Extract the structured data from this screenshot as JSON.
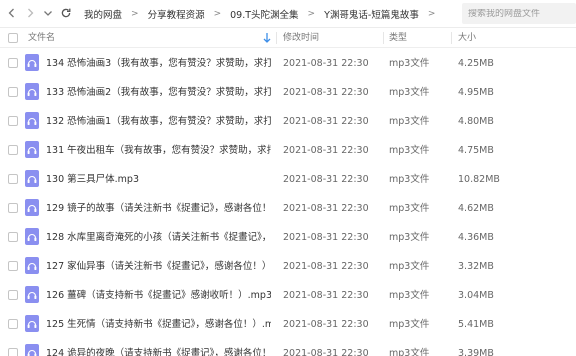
{
  "breadcrumb": [
    "我的网盘",
    "分享教程资源",
    "09.T头陀渊全集",
    "Y渊哥鬼话-短篇鬼故事"
  ],
  "search": {
    "placeholder": "搜索我的网盘文件"
  },
  "columns": {
    "name": "文件名",
    "date": "修改时间",
    "type": "类型",
    "size": "大小"
  },
  "colors": {
    "icon_bg": "#8a8ff0",
    "icon_fg": "#ffffff",
    "sort_arrow": "#3d8ee8"
  },
  "icons": {
    "file": "audio-file-icon",
    "back": "chevron-left-icon",
    "forward": "chevron-right-icon",
    "dropdown": "chevron-down-icon",
    "refresh": "refresh-icon"
  },
  "files": [
    {
      "name": "134 恐怖油画3（我有故事，您有赞没？求赞助，求打赏...",
      "date": "2021-08-31 22:30",
      "type": "mp3文件",
      "size": "4.25MB"
    },
    {
      "name": "133 恐怖油画2（我有故事，您有赞没？求赞助，求打赏...",
      "date": "2021-08-31 22:30",
      "type": "mp3文件",
      "size": "4.95MB"
    },
    {
      "name": "132 恐怖油画1（我有故事，您有赞没？求赞助，求打赏...",
      "date": "2021-08-31 22:30",
      "type": "mp3文件",
      "size": "4.80MB"
    },
    {
      "name": "131 午夜出租车（我有故事，您有赞没？求赞助，求打赏...",
      "date": "2021-08-31 22:30",
      "type": "mp3文件",
      "size": "4.75MB"
    },
    {
      "name": "130 第三具尸体.mp3",
      "date": "2021-08-31 22:30",
      "type": "mp3文件",
      "size": "10.82MB"
    },
    {
      "name": "129 镜子的故事（请关注新书《捉畫记》，感谢各位！）...",
      "date": "2021-08-31 22:30",
      "type": "mp3文件",
      "size": "4.62MB"
    },
    {
      "name": "128 水库里离奇淹死的小孩（请关注新书《捉畫记》，感...",
      "date": "2021-08-31 22:30",
      "type": "mp3文件",
      "size": "4.36MB"
    },
    {
      "name": "127 家仙异事（请关注新书《捉畫记》，感谢各位！）.mp...",
      "date": "2021-08-31 22:30",
      "type": "mp3文件",
      "size": "3.32MB"
    },
    {
      "name": "126 薑碑（请支持新书《捉畫记》感谢收听！）.mp3",
      "date": "2021-08-31 22:30",
      "type": "mp3文件",
      "size": "3.04MB"
    },
    {
      "name": "125 生死情（请支持新书《捉畫记》，感谢各位！）.mp3",
      "date": "2021-08-31 22:30",
      "type": "mp3文件",
      "size": "5.41MB"
    },
    {
      "name": "124 诡异的夜晚（请支持新书《捉畫记》，感谢各位！）...",
      "date": "2021-08-31 22:30",
      "type": "mp3文件",
      "size": "3.39MB"
    }
  ]
}
